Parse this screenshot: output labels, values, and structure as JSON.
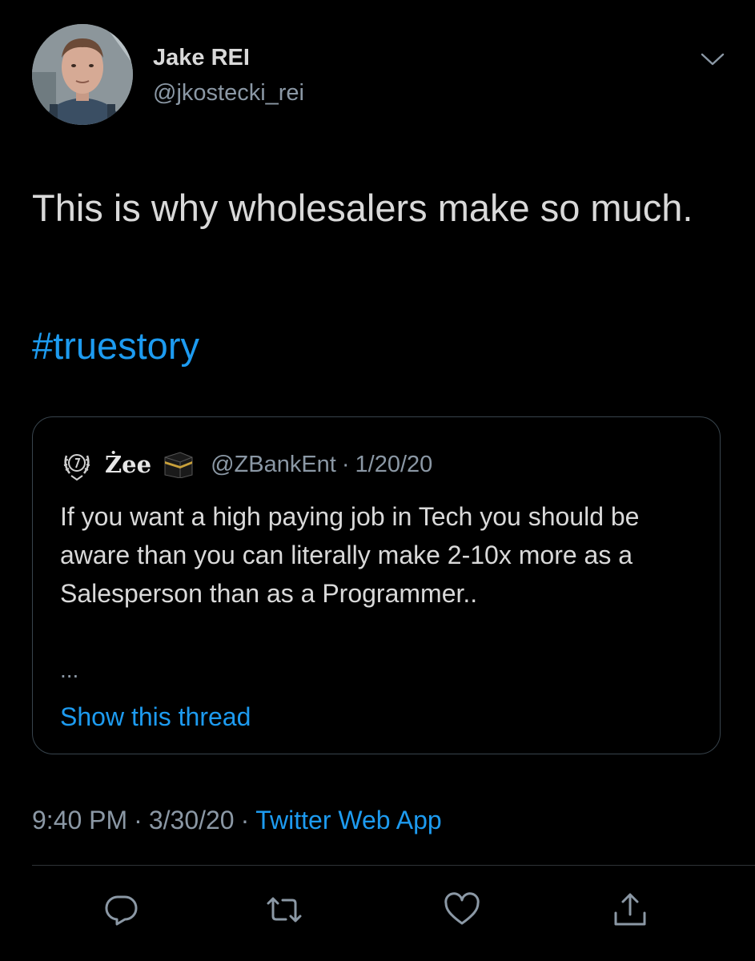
{
  "tweet": {
    "author": {
      "display_name": "Jake REI",
      "handle": "@jkostecki_rei"
    },
    "text": "This is why wholesalers make so much.",
    "hashtag": "#truestory",
    "timestamp": {
      "time": "9:40 PM",
      "separator": "·",
      "date": "3/30/20",
      "source": "Twitter Web App"
    }
  },
  "quoted_tweet": {
    "display_name": "Żee",
    "handle": "@ZBankEnt",
    "separator": "·",
    "date": "1/20/20",
    "text": "If you want a high paying job in Tech you should be aware than you can literally make 2-10x more as a Salesperson than as a Programmer..",
    "ellipsis": "...",
    "show_thread_label": "Show this thread"
  },
  "icons": {
    "more": "chevron-down-icon",
    "reply": "reply-icon",
    "retweet": "retweet-icon",
    "like": "heart-icon",
    "share": "share-icon"
  },
  "colors": {
    "background": "#000000",
    "text_primary": "#d9d9d9",
    "text_secondary": "#8b98a5",
    "accent": "#1d9bf0",
    "border": "#38444d"
  }
}
